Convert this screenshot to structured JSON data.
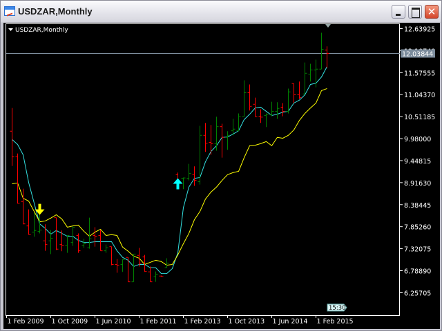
{
  "window": {
    "title": "USDZAR,Monthly",
    "minimize": "_",
    "maximize": "□",
    "close": "✕"
  },
  "chart_label": "USDZAR,Monthly",
  "colors": {
    "up": "#008000",
    "down": "#ff0000",
    "fast_ma": "#33e0e0",
    "slow_ma": "#ffff00",
    "bg": "#000000",
    "grid_line": "#8090a0"
  },
  "chart_data": {
    "type": "ohlc",
    "title": "USDZAR,Monthly",
    "ylim": [
      6.0,
      12.75
    ],
    "y_ticks": [
      "12.63925",
      "12.10740",
      "11.57555",
      "11.04370",
      "10.51185",
      "9.98000",
      "9.44815",
      "8.91630",
      "8.38445",
      "7.85260",
      "7.32075",
      "6.78890",
      "6.25705"
    ],
    "y_tick_values": [
      12.63925,
      12.1074,
      11.57555,
      11.0437,
      10.51185,
      9.98,
      9.44815,
      8.9163,
      8.38445,
      7.8526,
      7.32075,
      6.7889,
      6.25705
    ],
    "current_price": "12.03844",
    "current_price_value": 12.03844,
    "x_labels": [
      {
        "label": "1 Feb 2009",
        "bar": -1
      },
      {
        "label": "1 Oct 2009",
        "bar": 7
      },
      {
        "label": "1 Jun 2010",
        "bar": 15
      },
      {
        "label": "1 Feb 2011",
        "bar": 23
      },
      {
        "label": "1 Feb 2013",
        "bar": 31
      },
      {
        "label": "1 Oct 2013",
        "bar": 39
      },
      {
        "label": "1 Jun 2014",
        "bar": 47
      },
      {
        "label": "1 Feb 2015",
        "bar": 55
      }
    ],
    "time_label": "15:30",
    "bars": [
      [
        10.16,
        10.72,
        9.32,
        9.54
      ],
      [
        9.54,
        9.62,
        8.41,
        8.42
      ],
      [
        8.46,
        8.77,
        7.91,
        7.92
      ],
      [
        7.87,
        8.27,
        7.66,
        7.66
      ],
      [
        7.72,
        8.19,
        7.61,
        7.76
      ],
      [
        7.74,
        8.34,
        7.69,
        7.77
      ],
      [
        7.51,
        7.91,
        7.27,
        7.42
      ],
      [
        7.51,
        7.77,
        7.19,
        7.57
      ],
      [
        8.07,
        8.07,
        7.29,
        7.31
      ],
      [
        7.42,
        7.76,
        7.26,
        7.39
      ],
      [
        7.39,
        7.64,
        7.22,
        7.64
      ],
      [
        7.47,
        7.86,
        7.39,
        7.84
      ],
      [
        7.64,
        7.69,
        7.22,
        7.27
      ],
      [
        7.39,
        7.56,
        7.34,
        7.44
      ],
      [
        7.34,
        8.07,
        7.32,
        7.56
      ],
      [
        7.64,
        7.84,
        7.37,
        7.62
      ],
      [
        7.64,
        7.77,
        7.27,
        7.27
      ],
      [
        7.27,
        7.42,
        7.22,
        7.34
      ],
      [
        7.37,
        7.37,
        6.92,
        6.94
      ],
      [
        6.94,
        7.07,
        6.74,
        6.92
      ],
      [
        6.94,
        7.06,
        6.76,
        7.06
      ],
      [
        7.11,
        7.11,
        6.52,
        6.52
      ],
      [
        6.52,
        7.19,
        6.52,
        7.19
      ],
      [
        7.16,
        7.34,
        6.89,
        6.97
      ],
      [
        7.12,
        7.17,
        6.76,
        6.77
      ],
      [
        6.76,
        6.89,
        6.52,
        6.52
      ],
      [
        6.64,
        6.77,
        6.52,
        6.69
      ],
      [
        6.66,
        6.67,
        6.64,
        6.65
      ],
      [
        6.86,
        7.09,
        6.86,
        6.97
      ],
      null,
      [
        9.11,
        9.16,
        8.84,
        8.94
      ],
      [
        9.02,
        9.04,
        8.76,
        9.03
      ],
      [
        9.02,
        9.37,
        8.97,
        9.14
      ],
      [
        9.11,
        9.31,
        8.84,
        8.97
      ],
      [
        8.94,
        10.29,
        8.87,
        10.06
      ],
      [
        10.06,
        10.36,
        9.66,
        9.87
      ],
      [
        9.89,
        10.31,
        9.59,
        9.86
      ],
      [
        9.86,
        10.51,
        9.69,
        10.27
      ],
      [
        10.27,
        10.34,
        9.52,
        10.01
      ],
      [
        10.01,
        10.16,
        9.71,
        10.06
      ],
      [
        10.17,
        10.46,
        10.06,
        10.21
      ],
      [
        10.17,
        10.59,
        10.16,
        10.51
      ],
      [
        10.51,
        11.39,
        10.51,
        11.09
      ],
      [
        11.09,
        11.29,
        10.66,
        10.76
      ],
      [
        10.81,
        10.97,
        10.51,
        10.51
      ],
      [
        10.52,
        10.69,
        10.36,
        10.5
      ],
      [
        10.54,
        10.59,
        10.26,
        10.57
      ],
      [
        10.56,
        10.87,
        10.52,
        10.64
      ],
      [
        10.64,
        10.86,
        10.46,
        10.71
      ],
      [
        10.74,
        10.84,
        10.52,
        10.64
      ],
      [
        10.64,
        11.19,
        10.59,
        11.11
      ],
      [
        11.31,
        11.31,
        10.84,
        11.04
      ],
      [
        11.04,
        11.36,
        10.94,
        10.97
      ],
      [
        11.06,
        11.82,
        11.06,
        11.56
      ],
      [
        11.54,
        11.79,
        11.36,
        11.64
      ],
      [
        11.64,
        11.89,
        11.22,
        11.66
      ],
      [
        11.66,
        12.54,
        11.66,
        12.14
      ],
      [
        12.12,
        12.21,
        11.69,
        12.04
      ]
    ],
    "series": [
      {
        "name": "fast_ma",
        "values": [
          9.96,
          9.84,
          9.59,
          8.92,
          8.42,
          7.92,
          7.81,
          7.67,
          7.76,
          7.69,
          7.62,
          7.62,
          7.52,
          7.47,
          7.47,
          7.49,
          7.49,
          7.49,
          7.49,
          7.27,
          7.11,
          7.04,
          6.89,
          6.94,
          6.94,
          6.86,
          6.86,
          6.72,
          6.72,
          6.84,
          7.22,
          8.31,
          8.81,
          9.02,
          9.04,
          9.42,
          9.67,
          9.81,
          10.01,
          10.02,
          10.09,
          10.17,
          10.44,
          10.57,
          10.72,
          10.74,
          10.64,
          10.54,
          10.57,
          10.62,
          10.64,
          10.84,
          10.91,
          11.04,
          11.29,
          11.32,
          11.47,
          11.72
        ]
      },
      {
        "name": "slow_ma",
        "values": [
          8.89,
          8.91,
          8.54,
          8.47,
          8.22,
          7.97,
          7.99,
          8.06,
          8.14,
          8.04,
          7.84,
          7.87,
          7.89,
          7.74,
          7.62,
          7.72,
          7.79,
          7.64,
          7.66,
          7.64,
          7.36,
          7.26,
          7.14,
          7.09,
          6.94,
          6.99,
          7.04,
          7.01,
          6.92,
          6.94,
          7.17,
          7.44,
          7.69,
          8.02,
          8.22,
          8.52,
          8.69,
          8.81,
          8.97,
          9.11,
          9.16,
          9.19,
          9.52,
          9.81,
          9.82,
          9.86,
          9.91,
          9.81,
          10.01,
          9.99,
          10.06,
          10.19,
          10.42,
          10.59,
          10.72,
          10.84,
          11.14,
          11.19
        ]
      }
    ],
    "signals": [
      {
        "type": "sell",
        "bar": 5,
        "price": 8.27,
        "color": "#ffff00"
      },
      {
        "type": "buy",
        "bar": 30,
        "price": 8.89,
        "color": "#00ffff"
      }
    ]
  }
}
